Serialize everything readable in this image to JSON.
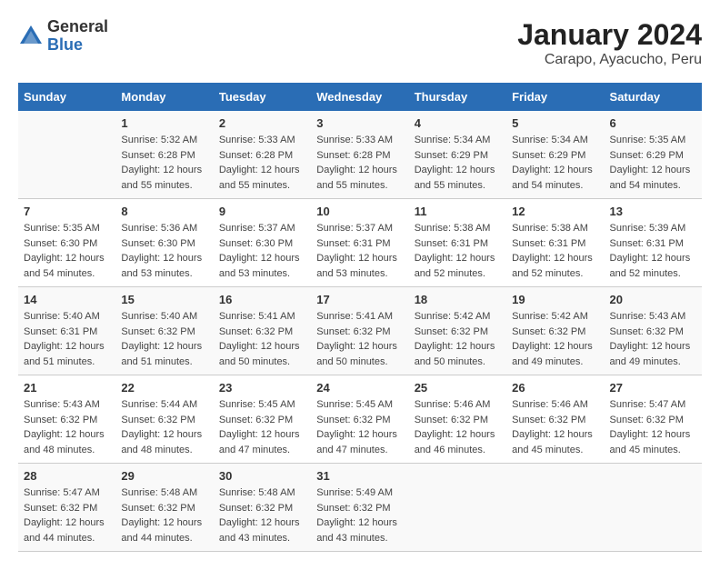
{
  "header": {
    "logo_line1": "General",
    "logo_line2": "Blue",
    "title": "January 2024",
    "subtitle": "Carapo, Ayacucho, Peru"
  },
  "columns": [
    "Sunday",
    "Monday",
    "Tuesday",
    "Wednesday",
    "Thursday",
    "Friday",
    "Saturday"
  ],
  "weeks": [
    [
      {
        "day": "",
        "info": ""
      },
      {
        "day": "1",
        "info": "Sunrise: 5:32 AM\nSunset: 6:28 PM\nDaylight: 12 hours\nand 55 minutes."
      },
      {
        "day": "2",
        "info": "Sunrise: 5:33 AM\nSunset: 6:28 PM\nDaylight: 12 hours\nand 55 minutes."
      },
      {
        "day": "3",
        "info": "Sunrise: 5:33 AM\nSunset: 6:28 PM\nDaylight: 12 hours\nand 55 minutes."
      },
      {
        "day": "4",
        "info": "Sunrise: 5:34 AM\nSunset: 6:29 PM\nDaylight: 12 hours\nand 55 minutes."
      },
      {
        "day": "5",
        "info": "Sunrise: 5:34 AM\nSunset: 6:29 PM\nDaylight: 12 hours\nand 54 minutes."
      },
      {
        "day": "6",
        "info": "Sunrise: 5:35 AM\nSunset: 6:29 PM\nDaylight: 12 hours\nand 54 minutes."
      }
    ],
    [
      {
        "day": "7",
        "info": "Sunrise: 5:35 AM\nSunset: 6:30 PM\nDaylight: 12 hours\nand 54 minutes."
      },
      {
        "day": "8",
        "info": "Sunrise: 5:36 AM\nSunset: 6:30 PM\nDaylight: 12 hours\nand 53 minutes."
      },
      {
        "day": "9",
        "info": "Sunrise: 5:37 AM\nSunset: 6:30 PM\nDaylight: 12 hours\nand 53 minutes."
      },
      {
        "day": "10",
        "info": "Sunrise: 5:37 AM\nSunset: 6:31 PM\nDaylight: 12 hours\nand 53 minutes."
      },
      {
        "day": "11",
        "info": "Sunrise: 5:38 AM\nSunset: 6:31 PM\nDaylight: 12 hours\nand 52 minutes."
      },
      {
        "day": "12",
        "info": "Sunrise: 5:38 AM\nSunset: 6:31 PM\nDaylight: 12 hours\nand 52 minutes."
      },
      {
        "day": "13",
        "info": "Sunrise: 5:39 AM\nSunset: 6:31 PM\nDaylight: 12 hours\nand 52 minutes."
      }
    ],
    [
      {
        "day": "14",
        "info": "Sunrise: 5:40 AM\nSunset: 6:31 PM\nDaylight: 12 hours\nand 51 minutes."
      },
      {
        "day": "15",
        "info": "Sunrise: 5:40 AM\nSunset: 6:32 PM\nDaylight: 12 hours\nand 51 minutes."
      },
      {
        "day": "16",
        "info": "Sunrise: 5:41 AM\nSunset: 6:32 PM\nDaylight: 12 hours\nand 50 minutes."
      },
      {
        "day": "17",
        "info": "Sunrise: 5:41 AM\nSunset: 6:32 PM\nDaylight: 12 hours\nand 50 minutes."
      },
      {
        "day": "18",
        "info": "Sunrise: 5:42 AM\nSunset: 6:32 PM\nDaylight: 12 hours\nand 50 minutes."
      },
      {
        "day": "19",
        "info": "Sunrise: 5:42 AM\nSunset: 6:32 PM\nDaylight: 12 hours\nand 49 minutes."
      },
      {
        "day": "20",
        "info": "Sunrise: 5:43 AM\nSunset: 6:32 PM\nDaylight: 12 hours\nand 49 minutes."
      }
    ],
    [
      {
        "day": "21",
        "info": "Sunrise: 5:43 AM\nSunset: 6:32 PM\nDaylight: 12 hours\nand 48 minutes."
      },
      {
        "day": "22",
        "info": "Sunrise: 5:44 AM\nSunset: 6:32 PM\nDaylight: 12 hours\nand 48 minutes."
      },
      {
        "day": "23",
        "info": "Sunrise: 5:45 AM\nSunset: 6:32 PM\nDaylight: 12 hours\nand 47 minutes."
      },
      {
        "day": "24",
        "info": "Sunrise: 5:45 AM\nSunset: 6:32 PM\nDaylight: 12 hours\nand 47 minutes."
      },
      {
        "day": "25",
        "info": "Sunrise: 5:46 AM\nSunset: 6:32 PM\nDaylight: 12 hours\nand 46 minutes."
      },
      {
        "day": "26",
        "info": "Sunrise: 5:46 AM\nSunset: 6:32 PM\nDaylight: 12 hours\nand 45 minutes."
      },
      {
        "day": "27",
        "info": "Sunrise: 5:47 AM\nSunset: 6:32 PM\nDaylight: 12 hours\nand 45 minutes."
      }
    ],
    [
      {
        "day": "28",
        "info": "Sunrise: 5:47 AM\nSunset: 6:32 PM\nDaylight: 12 hours\nand 44 minutes."
      },
      {
        "day": "29",
        "info": "Sunrise: 5:48 AM\nSunset: 6:32 PM\nDaylight: 12 hours\nand 44 minutes."
      },
      {
        "day": "30",
        "info": "Sunrise: 5:48 AM\nSunset: 6:32 PM\nDaylight: 12 hours\nand 43 minutes."
      },
      {
        "day": "31",
        "info": "Sunrise: 5:49 AM\nSunset: 6:32 PM\nDaylight: 12 hours\nand 43 minutes."
      },
      {
        "day": "",
        "info": ""
      },
      {
        "day": "",
        "info": ""
      },
      {
        "day": "",
        "info": ""
      }
    ]
  ]
}
